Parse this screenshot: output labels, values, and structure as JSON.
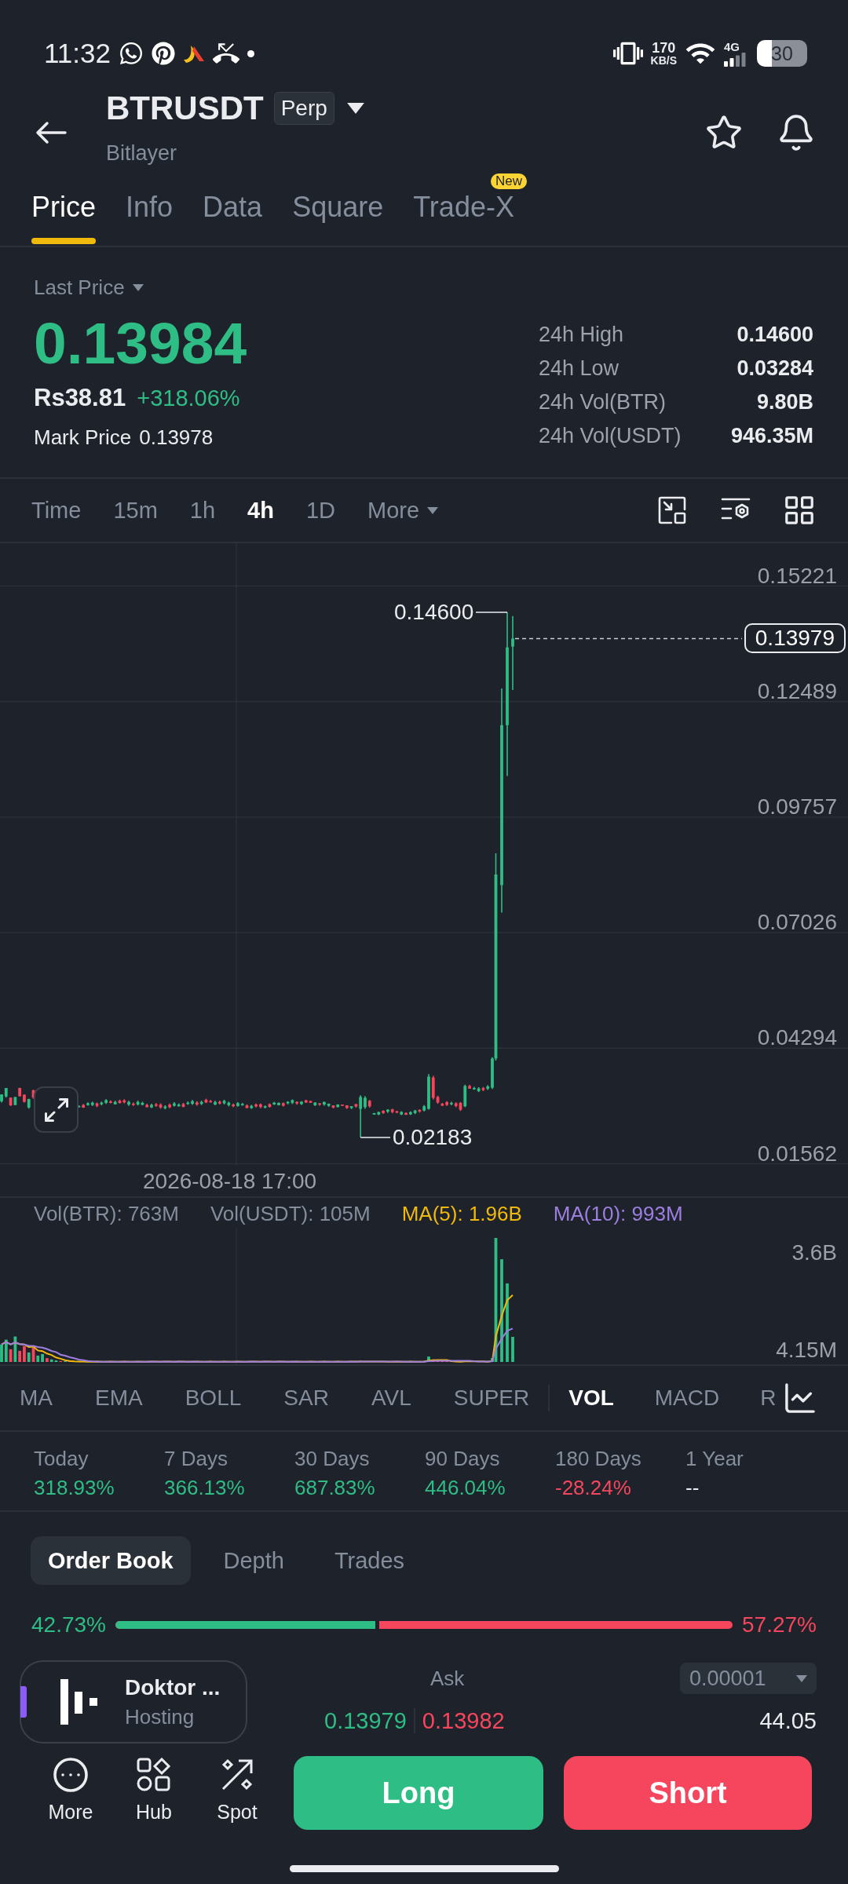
{
  "status_bar": {
    "time": "11:32",
    "net_speed": "170",
    "net_speed_unit": "KB/S",
    "network_type": "4G",
    "battery": "30"
  },
  "header": {
    "symbol": "BTRUSDT",
    "contract_badge": "Perp",
    "subtitle": "Bitlayer"
  },
  "tabs": [
    {
      "label": "Price",
      "selected": true
    },
    {
      "label": "Info",
      "selected": false
    },
    {
      "label": "Data",
      "selected": false
    },
    {
      "label": "Square",
      "selected": false
    },
    {
      "label": "Trade-X",
      "selected": false,
      "badge": "New"
    }
  ],
  "price": {
    "selector": "Last Price",
    "last": "0.13984",
    "fiat": "Rs38.81",
    "change": "+318.06%",
    "mark_label": "Mark Price",
    "mark": "0.13978"
  },
  "stats": [
    {
      "label": "24h High",
      "value": "0.14600"
    },
    {
      "label": "24h Low",
      "value": "0.03284"
    },
    {
      "label": "24h Vol(BTR)",
      "value": "9.80B"
    },
    {
      "label": "24h Vol(USDT)",
      "value": "946.35M"
    }
  ],
  "intervals": [
    {
      "label": "Time",
      "kind": "interval",
      "selected": false
    },
    {
      "label": "15m",
      "kind": "interval",
      "selected": false
    },
    {
      "label": "1h",
      "kind": "interval",
      "selected": false
    },
    {
      "label": "4h",
      "kind": "interval",
      "selected": true
    },
    {
      "label": "1D",
      "kind": "interval",
      "selected": false
    },
    {
      "label": "More",
      "kind": "dropdown",
      "selected": false
    }
  ],
  "chart": {
    "price_axis": [
      "0.15221",
      "0.12489",
      "0.09757",
      "0.07026",
      "0.04294",
      "0.01562"
    ],
    "high_marker": "0.14600",
    "low_marker": "0.02183",
    "last_price_tag": "0.13979",
    "time_axis": "2026-08-18 17:00"
  },
  "volume": {
    "legend": [
      {
        "text": "Vol(BTR): 763M",
        "color": "#848e9c"
      },
      {
        "text": "Vol(USDT): 105M",
        "color": "#848e9c"
      },
      {
        "text": "MA(5): 1.96B",
        "color": "#f0b90b"
      },
      {
        "text": "MA(10): 993M",
        "color": "#9c7fe0"
      }
    ],
    "axis": [
      "3.6B",
      "4.15M"
    ]
  },
  "indicators": {
    "main": [
      {
        "label": "MA",
        "selected": false
      },
      {
        "label": "EMA",
        "selected": false
      },
      {
        "label": "BOLL",
        "selected": false
      },
      {
        "label": "SAR",
        "selected": false
      },
      {
        "label": "AVL",
        "selected": false
      },
      {
        "label": "SUPER",
        "selected": false
      }
    ],
    "sub": [
      {
        "label": "VOL",
        "selected": true
      },
      {
        "label": "MACD",
        "selected": false
      },
      {
        "label": "R",
        "selected": false
      }
    ]
  },
  "performance": [
    {
      "period": "Today",
      "value": "318.93%",
      "color": "#2ebd85"
    },
    {
      "period": "7 Days",
      "value": "366.13%",
      "color": "#2ebd85"
    },
    {
      "period": "30 Days",
      "value": "687.83%",
      "color": "#2ebd85"
    },
    {
      "period": "90 Days",
      "value": "446.04%",
      "color": "#2ebd85"
    },
    {
      "period": "180 Days",
      "value": "-28.24%",
      "color": "#f6465d"
    },
    {
      "period": "1 Year",
      "value": "--",
      "color": "#eaecef"
    }
  ],
  "book_tabs": [
    {
      "label": "Order Book",
      "selected": true
    },
    {
      "label": "Depth",
      "selected": false
    },
    {
      "label": "Trades",
      "selected": false
    }
  ],
  "ratio": {
    "bid": "42.73%",
    "ask": "57.27%",
    "level": 0.4273
  },
  "promo": {
    "title": "Doktor ...",
    "subtitle": "Hosting"
  },
  "order_book": {
    "ask_header": "Ask",
    "precision": "0.00001",
    "bid_price": "0.13979",
    "ask_price": "0.13982",
    "amount": "44.05"
  },
  "nav": [
    {
      "label": "More",
      "kind": "more"
    },
    {
      "label": "Hub",
      "kind": "hub"
    },
    {
      "label": "Spot",
      "kind": "spot"
    }
  ],
  "actions": [
    {
      "label": "Long",
      "kind": "long"
    },
    {
      "label": "Short",
      "kind": "short"
    }
  ]
}
